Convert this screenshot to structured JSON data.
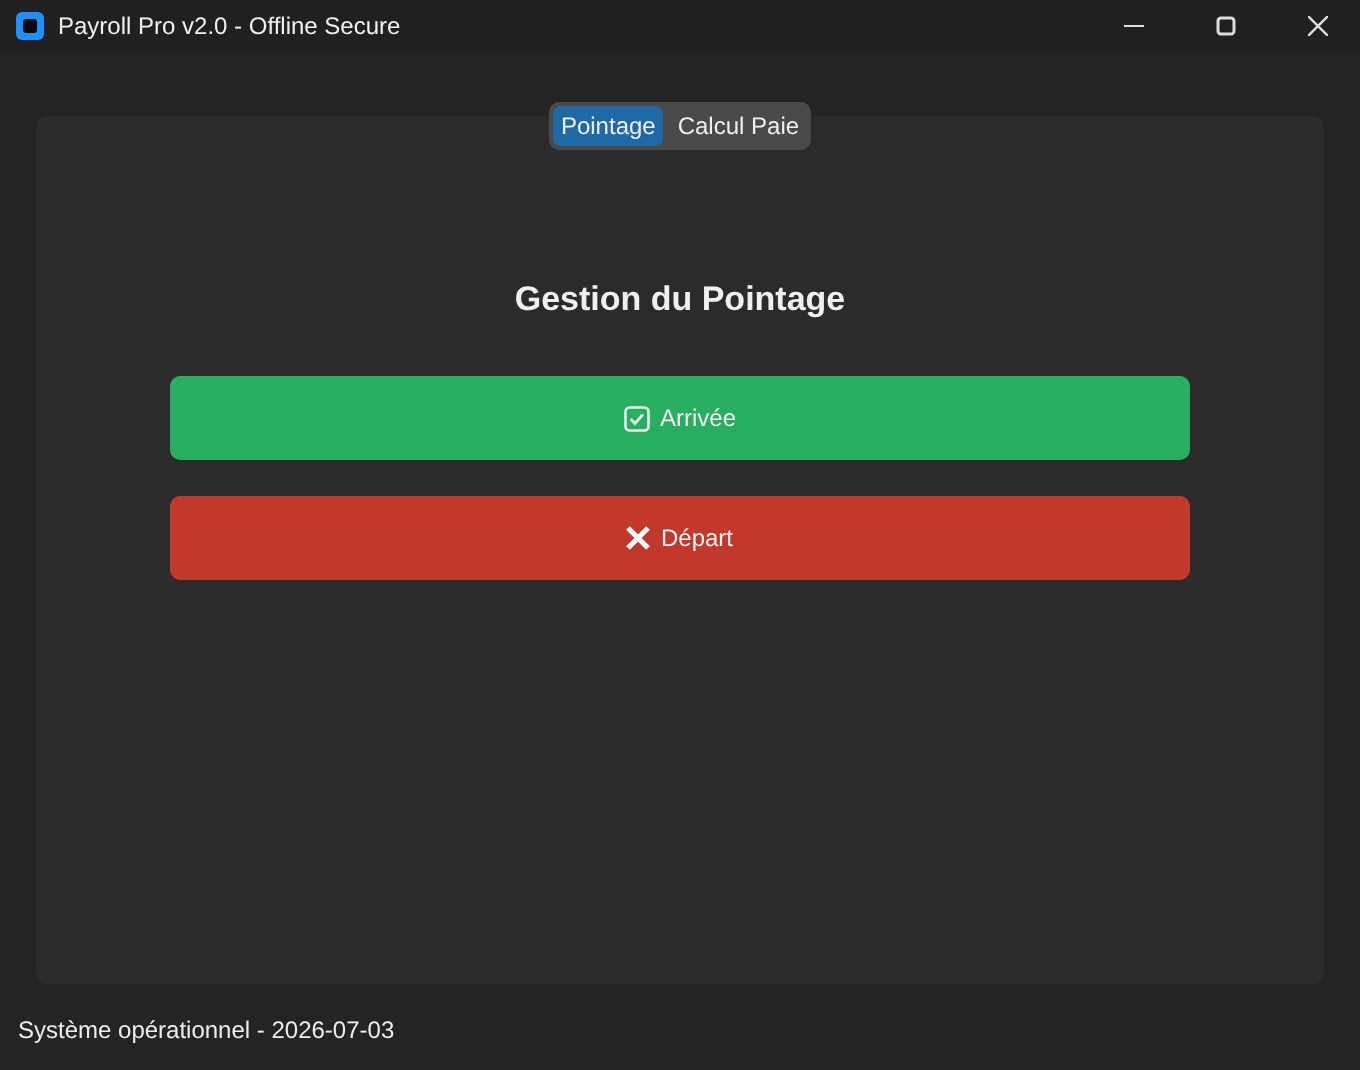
{
  "window": {
    "title": "Payroll Pro v2.0 - Offline Secure"
  },
  "tabs": [
    {
      "label": "Pointage",
      "selected": true
    },
    {
      "label": "Calcul Paie",
      "selected": false
    }
  ],
  "panel": {
    "heading": "Gestion du Pointage",
    "buttons": [
      {
        "label": "Arrivée",
        "kind": "check",
        "color": "#27ae60"
      },
      {
        "label": "Départ",
        "kind": "cross",
        "color": "#c0392b"
      }
    ]
  },
  "status_bar": "Système opérationnel - 2026-07-03"
}
